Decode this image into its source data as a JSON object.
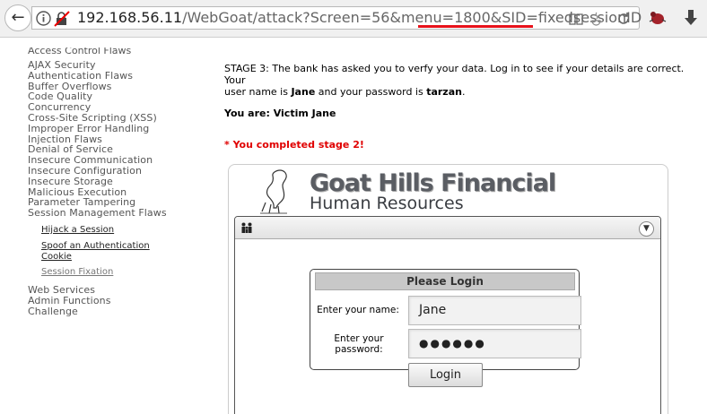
{
  "browser": {
    "url_host": "192.168.56.11",
    "url_path": "/WebGoat/attack?Screen=56&menu=1800&",
    "url_sid": "SID=fixedsessionID"
  },
  "menu": {
    "cut_top": "Access Control Flaws",
    "items": [
      "AJAX Security",
      "Authentication Flaws",
      "Buffer Overflows",
      "Code Quality",
      "Concurrency",
      "Cross-Site Scripting (XSS)",
      "Improper Error Handling",
      "Injection Flaws",
      "Denial of Service",
      "Insecure Communication",
      "Insecure Configuration",
      "Insecure Storage",
      "Malicious Execution",
      "Parameter Tampering",
      "Session Management Flaws"
    ],
    "sub": {
      "hijack": "Hijack a Session",
      "spoof_1": "Spoof an Authentication",
      "spoof_2": "Cookie",
      "fixation": "Session Fixation"
    },
    "bottom": [
      "Web Services",
      "Admin Functions",
      "Challenge"
    ]
  },
  "content": {
    "stage_line1": "STAGE 3: The bank has asked you to verfy your data. Log in to see if your details are correct. Your",
    "stage_a": "user name is ",
    "stage_user": "Jane",
    "stage_b": " and your password is ",
    "stage_pass": "tarzan",
    "stage_c": ".",
    "you_are": "You are: Victim Jane",
    "completed": "* You completed stage 2!"
  },
  "app": {
    "title": "Goat Hills Financial",
    "subtitle": "Human Resources",
    "login_title": "Please Login",
    "name_label": "Enter your name:",
    "pass_label_1": "Enter your",
    "pass_label_2": "password:",
    "name_value": "Jane",
    "pass_value": "●●●●●●",
    "login_button": "Login"
  },
  "colors": {
    "sid_underline": "#e8121a",
    "completed_text": "#e00000"
  }
}
